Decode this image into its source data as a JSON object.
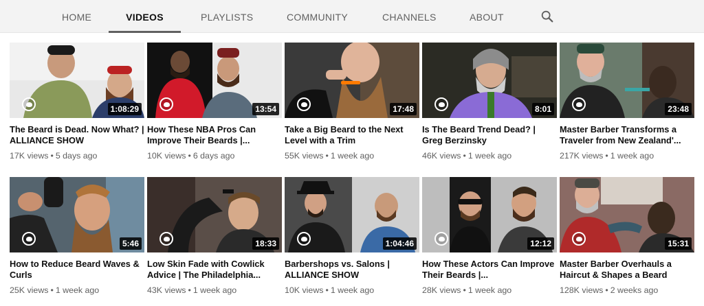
{
  "tabs": [
    {
      "label": "HOME",
      "active": false
    },
    {
      "label": "VIDEOS",
      "active": true
    },
    {
      "label": "PLAYLISTS",
      "active": false
    },
    {
      "label": "COMMUNITY",
      "active": false
    },
    {
      "label": "CHANNELS",
      "active": false
    },
    {
      "label": "ABOUT",
      "active": false
    }
  ],
  "search_icon": "search-icon",
  "videos": [
    {
      "title": "The Beard is Dead. Now What? | ALLIANCE SHOW",
      "duration": "1:08:29",
      "views": "17K views",
      "age": "5 days ago"
    },
    {
      "title": "How These NBA Pros Can Improve Their Beards |...",
      "duration": "13:54",
      "views": "10K views",
      "age": "6 days ago"
    },
    {
      "title": "Take a Big Beard to the Next Level with a Trim",
      "duration": "17:48",
      "views": "55K views",
      "age": "1 week ago"
    },
    {
      "title": "Is The Beard Trend Dead? | Greg Berzinsky",
      "duration": "8:01",
      "views": "46K views",
      "age": "1 week ago"
    },
    {
      "title": "Master Barber Transforms a Traveler from New Zealand'...",
      "duration": "23:48",
      "views": "217K views",
      "age": "1 week ago"
    },
    {
      "title": "How to Reduce Beard Waves & Curls",
      "duration": "5:46",
      "views": "25K views",
      "age": "1 week ago"
    },
    {
      "title": "Low Skin Fade with Cowlick Advice | The Philadelphia...",
      "duration": "18:33",
      "views": "43K views",
      "age": "1 week ago"
    },
    {
      "title": "Barbershops vs. Salons | ALLIANCE SHOW",
      "duration": "1:04:46",
      "views": "10K views",
      "age": "1 week ago"
    },
    {
      "title": "How These Actors Can Improve Their Beards |...",
      "duration": "12:12",
      "views": "28K views",
      "age": "1 week ago"
    },
    {
      "title": "Master Barber Overhauls a Haircut & Shapes a Beard",
      "duration": "15:31",
      "views": "128K views",
      "age": "2 weeks ago"
    }
  ],
  "colors": {
    "tabbar_bg": "#f3f3f3",
    "active_underline": "#606060",
    "meta_text": "#606060",
    "duration_bg": "#000000"
  }
}
